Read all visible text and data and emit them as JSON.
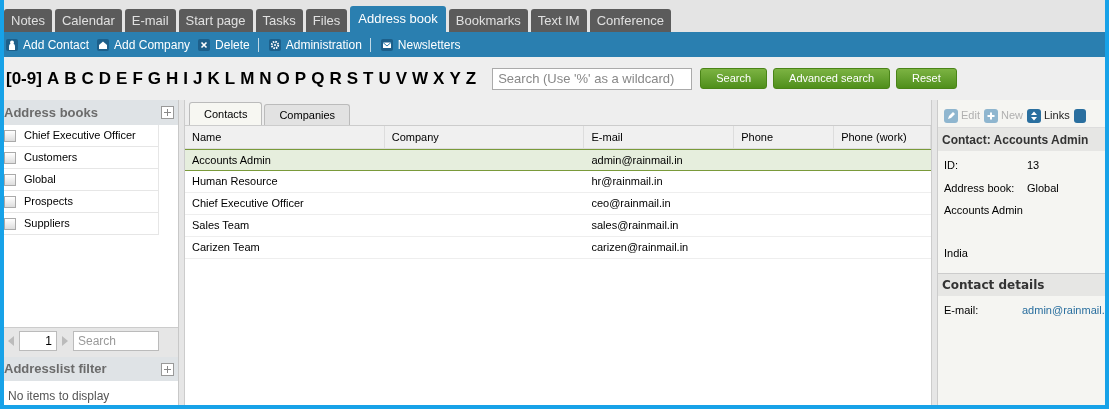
{
  "tabs": [
    {
      "label": "Notes",
      "selected": false
    },
    {
      "label": "Calendar",
      "selected": false
    },
    {
      "label": "E-mail",
      "selected": false
    },
    {
      "label": "Start page",
      "selected": false
    },
    {
      "label": "Tasks",
      "selected": false
    },
    {
      "label": "Files",
      "selected": false
    },
    {
      "label": "Address book",
      "selected": true
    },
    {
      "label": "Bookmarks",
      "selected": false
    },
    {
      "label": "Text IM",
      "selected": false
    },
    {
      "label": "Conference",
      "selected": false
    }
  ],
  "toolbar": [
    {
      "label": "Add Contact",
      "kind": "person",
      "separator_after": false
    },
    {
      "label": "Add Company",
      "kind": "house",
      "separator_after": false
    },
    {
      "label": "Delete",
      "kind": "cross",
      "separator_after": true
    },
    {
      "label": "Administration",
      "kind": "gear",
      "separator_after": true
    },
    {
      "label": "Newsletters",
      "kind": "envelope",
      "separator_after": false
    }
  ],
  "letters": [
    "[0-9]",
    "A",
    "B",
    "C",
    "D",
    "E",
    "F",
    "G",
    "H",
    "I",
    "J",
    "K",
    "L",
    "M",
    "N",
    "O",
    "P",
    "Q",
    "R",
    "S",
    "T",
    "U",
    "V",
    "W",
    "X",
    "Y",
    "Z"
  ],
  "search": {
    "placeholder": "Search (Use '%' as a wildcard)",
    "buttons": [
      "Search",
      "Advanced search",
      "Reset"
    ]
  },
  "address_books": {
    "title": "Address books",
    "items": [
      {
        "label": "Chief Executive Officer",
        "checked": false
      },
      {
        "label": "Customers",
        "checked": false
      },
      {
        "label": "Global",
        "checked": false
      },
      {
        "label": "Prospects",
        "checked": false
      },
      {
        "label": "Suppliers",
        "checked": false
      }
    ],
    "pager": {
      "page": "1",
      "placeholder": "Search"
    }
  },
  "filter": {
    "title": "Addresslist filter",
    "empty_text": "No items to display"
  },
  "content_tabs": [
    {
      "label": "Contacts",
      "selected": true
    },
    {
      "label": "Companies",
      "selected": false
    }
  ],
  "table": {
    "columns": [
      "Name",
      "Company",
      "E-mail",
      "Phone",
      "Phone (work)"
    ],
    "rows": [
      {
        "cells": [
          "Accounts Admin",
          "",
          "admin@rainmail.in",
          "",
          ""
        ],
        "selected": true
      },
      {
        "cells": [
          "Human Resource",
          "",
          "hr@rainmail.in",
          "",
          ""
        ],
        "selected": false
      },
      {
        "cells": [
          "Chief Executive Officer",
          "",
          "ceo@rainmail.in",
          "",
          ""
        ],
        "selected": false
      },
      {
        "cells": [
          "Sales Team",
          "",
          "sales@rainmail.in",
          "",
          ""
        ],
        "selected": false
      },
      {
        "cells": [
          "Carizen Team",
          "",
          "carizen@rainmail.in",
          "",
          ""
        ],
        "selected": false
      }
    ]
  },
  "detail": {
    "toolbar": [
      {
        "label": "Edit",
        "kind": "pencil",
        "disabled": true
      },
      {
        "label": "New",
        "kind": "plus",
        "disabled": true
      },
      {
        "label": "Links",
        "kind": "arrows",
        "disabled": false
      }
    ],
    "title": "Contact: Accounts Admin",
    "fields": [
      {
        "label": "ID:",
        "value": "13"
      },
      {
        "label": "Address book:",
        "value": "Global"
      }
    ],
    "lines": [
      "Accounts Admin",
      "India"
    ],
    "details_title": "Contact details",
    "details": [
      {
        "label": "E-mail:",
        "value": "admin@rainmail."
      }
    ]
  }
}
